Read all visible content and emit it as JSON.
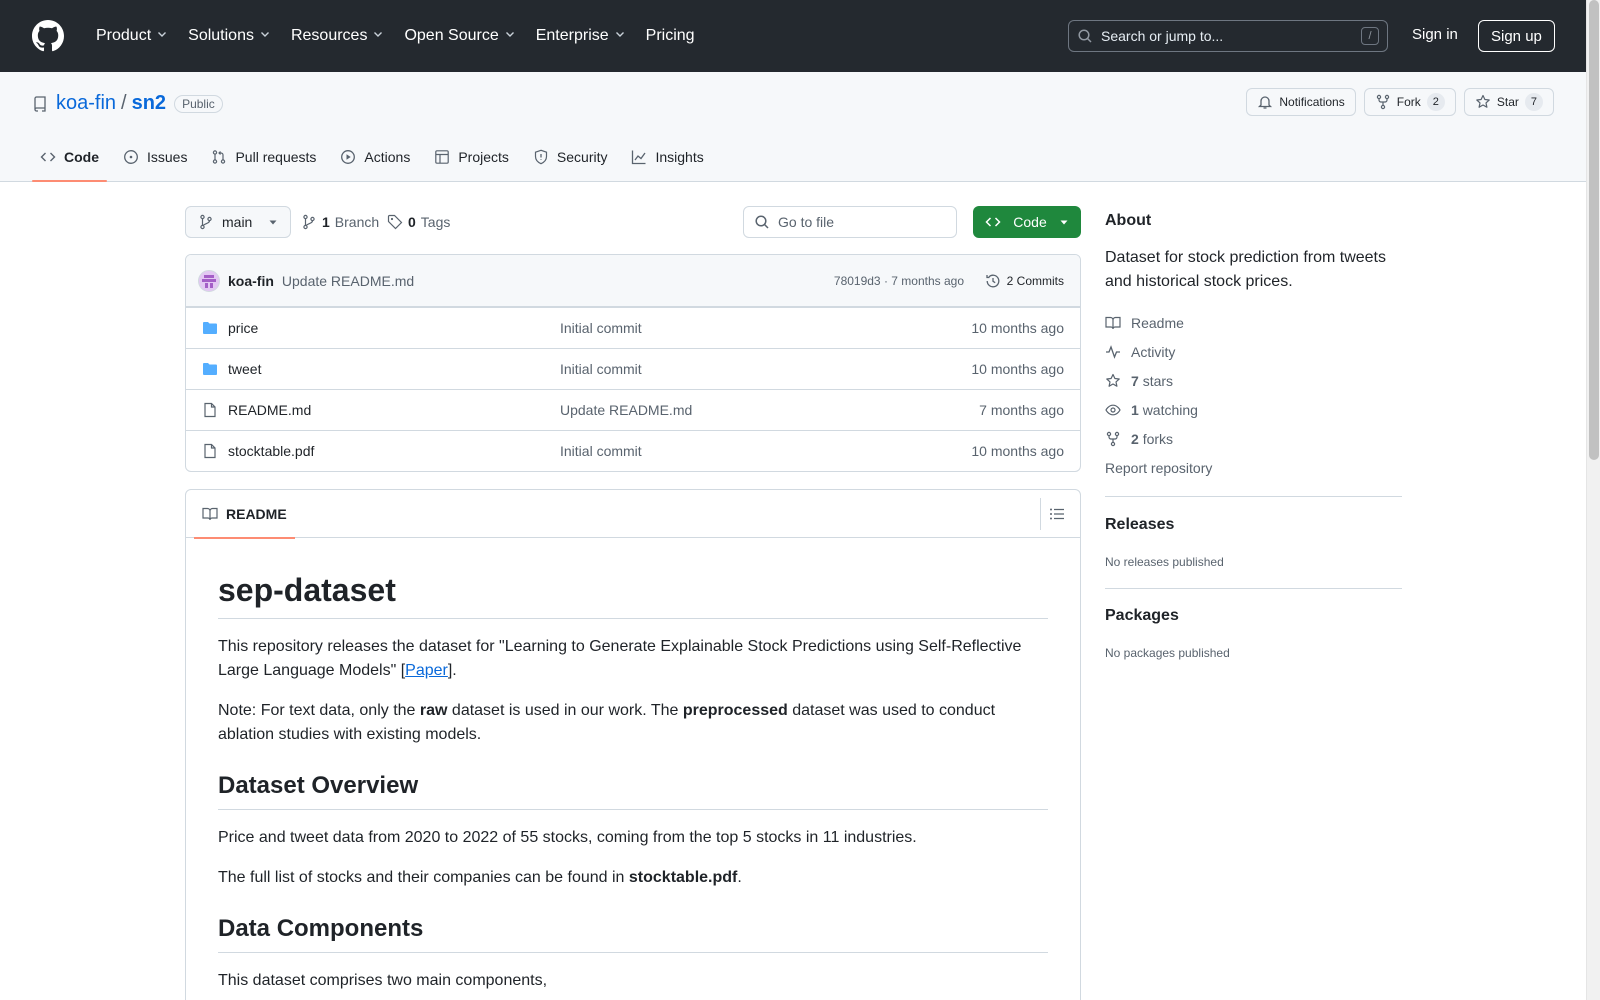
{
  "header": {
    "nav": [
      {
        "label": "Product",
        "has_menu": true
      },
      {
        "label": "Solutions",
        "has_menu": true
      },
      {
        "label": "Resources",
        "has_menu": true
      },
      {
        "label": "Open Source",
        "has_menu": true
      },
      {
        "label": "Enterprise",
        "has_menu": true
      },
      {
        "label": "Pricing",
        "has_menu": false
      }
    ],
    "search_placeholder": "Search or jump to...",
    "search_shortcut": "/",
    "sign_in": "Sign in",
    "sign_up": "Sign up"
  },
  "repo": {
    "owner": "koa-fin",
    "separator": "/",
    "name": "sn2",
    "visibility": "Public",
    "actions": {
      "notifications": "Notifications",
      "fork": "Fork",
      "fork_count": "2",
      "star": "Star",
      "star_count": "7"
    },
    "tabs": [
      {
        "label": "Code",
        "icon": "code-icon",
        "active": true
      },
      {
        "label": "Issues",
        "icon": "issue-icon",
        "active": false
      },
      {
        "label": "Pull requests",
        "icon": "pull-request-icon",
        "active": false
      },
      {
        "label": "Actions",
        "icon": "play-icon",
        "active": false
      },
      {
        "label": "Projects",
        "icon": "table-icon",
        "active": false
      },
      {
        "label": "Security",
        "icon": "shield-icon",
        "active": false
      },
      {
        "label": "Insights",
        "icon": "graph-icon",
        "active": false
      }
    ]
  },
  "toolbar": {
    "branch": "main",
    "branch_count": "1",
    "branch_label": "Branch",
    "tag_count": "0",
    "tag_label": "Tags",
    "goto_placeholder": "Go to file",
    "code_button": "Code"
  },
  "latest_commit": {
    "author": "koa-fin",
    "message": "Update README.md",
    "sha_time": "78019d3 · 7 months ago",
    "commits": "2 Commits"
  },
  "files": [
    {
      "name": "price",
      "type": "folder",
      "commit": "Initial commit",
      "date": "10 months ago"
    },
    {
      "name": "tweet",
      "type": "folder",
      "commit": "Initial commit",
      "date": "10 months ago"
    },
    {
      "name": "README.md",
      "type": "file",
      "commit": "Update README.md",
      "date": "7 months ago"
    },
    {
      "name": "stocktable.pdf",
      "type": "file",
      "commit": "Initial commit",
      "date": "10 months ago"
    }
  ],
  "readme": {
    "tab": "README",
    "h1": "sep-dataset",
    "p1_pre": "This repository releases the dataset for \"Learning to Generate Explainable Stock Predictions using Self-Reflective Large Language Models\" [",
    "p1_link": "Paper",
    "p1_post": "].",
    "p2_a": "Note: For text data, only the ",
    "p2_b": "raw",
    "p2_c": " dataset is used in our work. The ",
    "p2_d": "preprocessed",
    "p2_e": " dataset was used to conduct ablation studies with existing models.",
    "h2_overview": "Dataset Overview",
    "p3": "Price and tweet data from 2020 to 2022 of 55 stocks, coming from the top 5 stocks in 11 industries.",
    "p4_a": "The full list of stocks and their companies can be found in ",
    "p4_b": "stocktable.pdf",
    "p4_c": ".",
    "h2_components": "Data Components",
    "p5": "This dataset comprises two main components,"
  },
  "sidebar": {
    "about_title": "About",
    "description": "Dataset for stock prediction from tweets and historical stock prices.",
    "links": [
      {
        "icon": "book-icon",
        "count": "",
        "label": "Readme"
      },
      {
        "icon": "pulse-icon",
        "count": "",
        "label": "Activity"
      },
      {
        "icon": "star-icon",
        "count": "7",
        "label": "stars"
      },
      {
        "icon": "eye-icon",
        "count": "1",
        "label": "watching"
      },
      {
        "icon": "fork-icon",
        "count": "2",
        "label": "forks"
      }
    ],
    "report": "Report repository",
    "releases_title": "Releases",
    "releases_empty": "No releases published",
    "packages_title": "Packages",
    "packages_empty": "No packages published"
  },
  "colors": {
    "header_bg": "#24292f",
    "link": "#0969da",
    "code_button": "#1f883d",
    "active_tab_underline": "#fd8c73",
    "folder": "#54aeff"
  }
}
